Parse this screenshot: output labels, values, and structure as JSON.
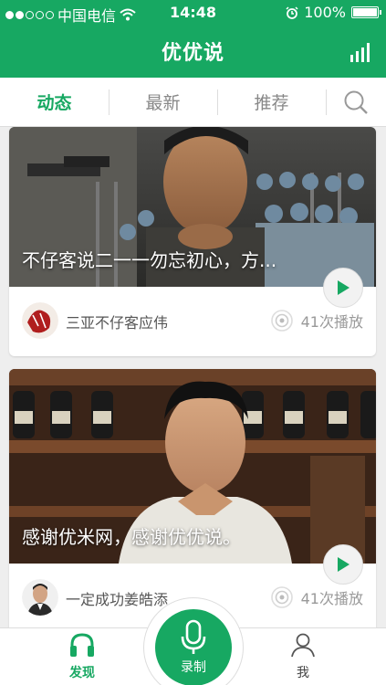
{
  "status_bar": {
    "carrier": "中国电信",
    "time": "14:48",
    "battery": "100%"
  },
  "header": {
    "title": "优优说"
  },
  "tabs": [
    {
      "label": "动态",
      "active": true
    },
    {
      "label": "最新",
      "active": false
    },
    {
      "label": "推荐",
      "active": false
    }
  ],
  "feed": [
    {
      "caption": "不仔客说二一一勿忘初心，方...",
      "author": "三亚不仔客应伟",
      "plays": "41次播放"
    },
    {
      "caption": "感谢优米网，感谢优优说。",
      "author": "一定成功姜皓添",
      "plays": "41次播放"
    }
  ],
  "bottom_nav": {
    "discover": "发现",
    "record": "录制",
    "me": "我"
  },
  "colors": {
    "brand_green": "#17a862"
  }
}
